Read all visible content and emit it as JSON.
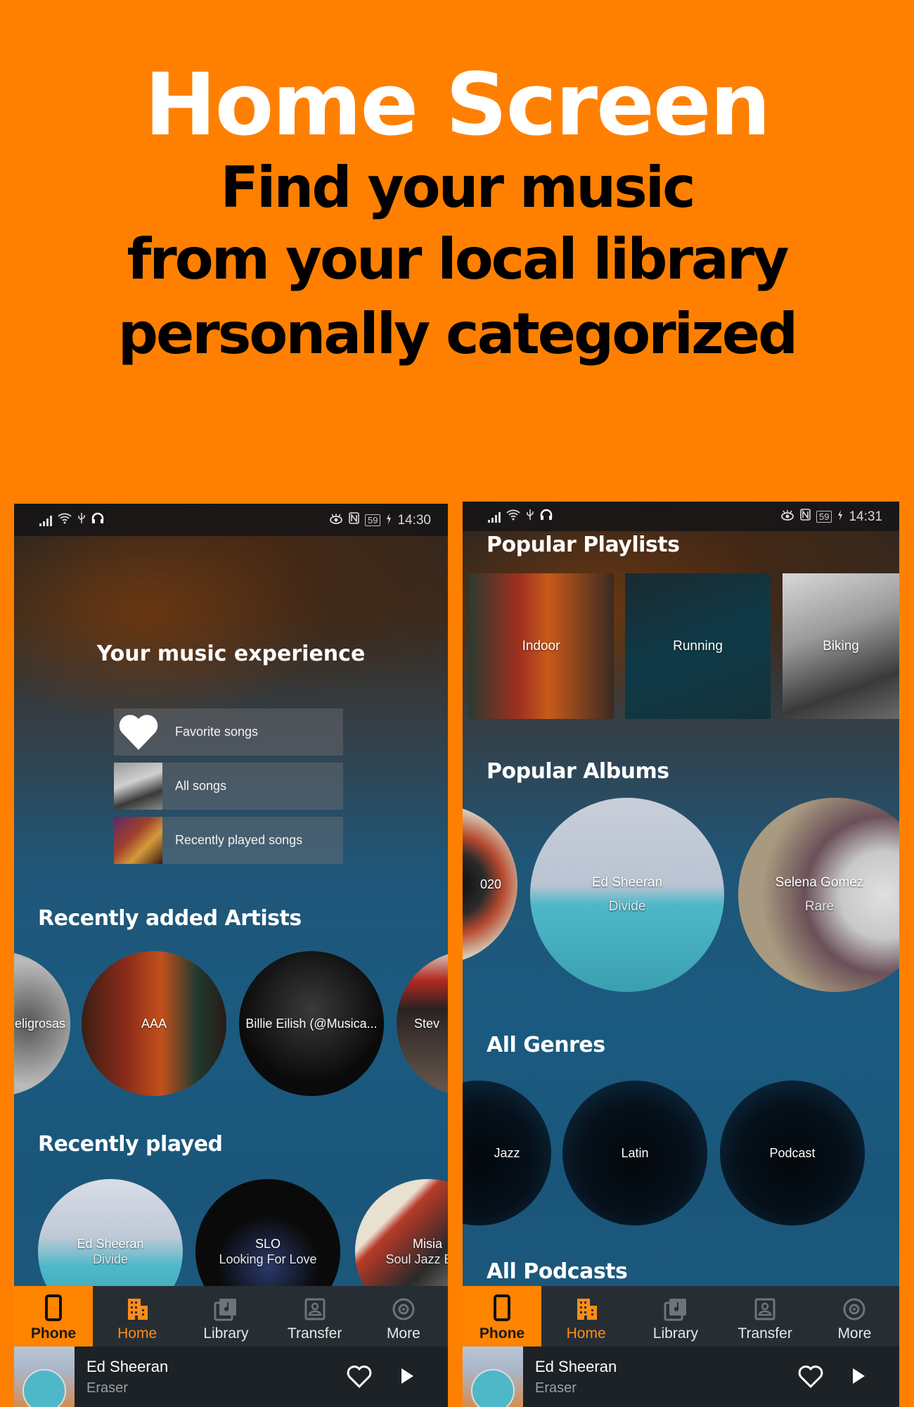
{
  "hero": {
    "title": "Home Screen",
    "subtitle_lines": [
      "Find your music",
      "from your local library",
      "personally categorized"
    ]
  },
  "colors": {
    "brand_orange": "#ff8000",
    "nav_background": "#262e33",
    "active_tab": "#ff8c1a"
  },
  "left_screen": {
    "status": {
      "time": "14:30",
      "battery": "59"
    },
    "header_title": "Your music experience",
    "quick_access": [
      {
        "label": "Favorite songs",
        "icon": "heart-icon"
      },
      {
        "label": "All songs",
        "icon": "turntable-thumbnail"
      },
      {
        "label": "Recently played songs",
        "icon": "saxophone-thumbnail"
      }
    ],
    "recently_added_artists": {
      "title": "Recently added Artists",
      "items": [
        {
          "name": "eligrosas"
        },
        {
          "name": "AAA"
        },
        {
          "name": "Billie Eilish (@Musica..."
        },
        {
          "name": "Stev"
        }
      ]
    },
    "recently_played": {
      "title": "Recently played",
      "items": [
        {
          "artist": "Ed Sheeran",
          "album": "Divide"
        },
        {
          "artist": "SLO",
          "album": "Looking For Love"
        },
        {
          "artist": "Misia",
          "album": "Soul Jazz Best"
        }
      ]
    }
  },
  "right_screen": {
    "status": {
      "time": "14:31",
      "battery": "59"
    },
    "popular_playlists": {
      "title": "Popular Playlists",
      "items": [
        {
          "name": "Indoor"
        },
        {
          "name": "Running"
        },
        {
          "name": "Biking"
        }
      ]
    },
    "popular_albums": {
      "title": "Popular Albums",
      "items": [
        {
          "artist": "",
          "album": "020"
        },
        {
          "artist": "Ed Sheeran",
          "album": "Divide"
        },
        {
          "artist": "Selena Gomez",
          "album": "Rare"
        }
      ]
    },
    "all_genres": {
      "title": "All Genres",
      "items": [
        {
          "name": "Jazz"
        },
        {
          "name": "Latin"
        },
        {
          "name": "Podcast"
        }
      ]
    },
    "all_podcasts": {
      "title": "All Podcasts"
    }
  },
  "nav": {
    "items": [
      {
        "label": "Phone",
        "icon": "phone-icon"
      },
      {
        "label": "Home",
        "icon": "home-buildings-icon",
        "active": true
      },
      {
        "label": "Library",
        "icon": "library-icon"
      },
      {
        "label": "Transfer",
        "icon": "transfer-icon"
      },
      {
        "label": "More",
        "icon": "more-disc-icon"
      }
    ]
  },
  "player": {
    "artist": "Ed Sheeran",
    "track": "Eraser"
  }
}
